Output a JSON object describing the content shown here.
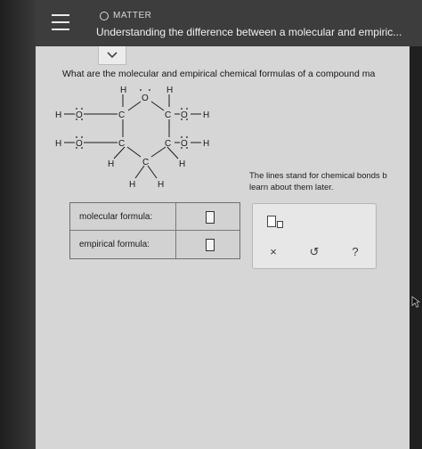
{
  "header": {
    "module_label": "MATTER",
    "title": "Understanding the difference between a molecular and empiric..."
  },
  "question": {
    "text": "What are the molecular and empirical chemical formulas of a compound ma",
    "note_line1": "The lines stand for chemical bonds b",
    "note_line2": "learn about them later."
  },
  "molecule": {
    "atoms": {
      "h_top_left": "H",
      "h_top_right": "H",
      "o_top": "O",
      "h_left1": "H",
      "o_left1": "O",
      "c_left1": "C",
      "c_right1": "C",
      "o_right1": "O",
      "h_right1": "H",
      "h_left2": "H",
      "o_left2": "O",
      "c_left2": "C",
      "c_right2": "C",
      "o_right2": "O",
      "h_right2": "H",
      "h_mid_left": "H",
      "h_mid_right": "H",
      "c_bottom": "C",
      "h_bottom_left": "H",
      "h_bottom_right": "H"
    }
  },
  "answers": {
    "molecular_label": "molecular formula:",
    "empirical_label": "empirical formula:"
  },
  "toolbox": {
    "clear_symbol": "×",
    "undo_symbol": "↺",
    "help_symbol": "?"
  },
  "icons": [
    "menu-icon",
    "module-circle-icon",
    "chevron-down-icon",
    "subscript-icon",
    "clear-icon",
    "undo-icon",
    "help-icon",
    "cursor-icon"
  ]
}
